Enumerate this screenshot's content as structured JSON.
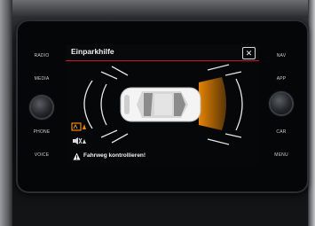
{
  "screen": {
    "title": "Einparkhilfe",
    "close_glyph": "✕",
    "warning": "Fahrweg kontrollieren!"
  },
  "hardware_buttons": {
    "left": [
      "RADIO",
      "MEDIA",
      "PHONE",
      "VOICE"
    ],
    "right": [
      "NAV",
      "APP",
      "CAR",
      "MENU"
    ]
  },
  "colors": {
    "accent_red": "#d10d2a",
    "warning_orange": "#f08a00",
    "sensor_white": "#e8e8e8"
  },
  "icons": {
    "close": "close-icon",
    "warning": "warning-triangle-icon",
    "park_mode": "parking-sensor-icon",
    "mute": "sound-off-icon"
  }
}
